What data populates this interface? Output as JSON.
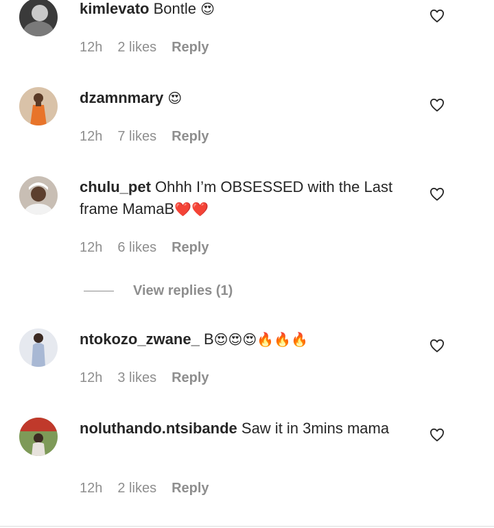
{
  "comments": [
    {
      "username": "kimlevato",
      "text": "Bontle",
      "emoji": "😍",
      "time": "12h",
      "likes": "2 likes",
      "reply": "Reply",
      "avatar_color": "#6b6b6b"
    },
    {
      "username": "dzamnmary",
      "text": "",
      "emoji": "😍",
      "time": "12h",
      "likes": "7 likes",
      "reply": "Reply",
      "avatar_color": "#e8742a"
    },
    {
      "username": "chulu_pet",
      "text": "Ohhh I’m OBSESSED with the Last frame MamaB",
      "emoji": "❤️❤️",
      "time": "12h",
      "likes": "6 likes",
      "reply": "Reply",
      "avatar_color": "#9a8f86"
    },
    {
      "username": "ntokozo_zwane_",
      "text": "B",
      "emoji": "😍😍😍🔥🔥🔥",
      "time": "12h",
      "likes": "3 likes",
      "reply": "Reply",
      "avatar_color": "#b9c4d6"
    },
    {
      "username": "noluthando.ntsibande",
      "text": "Saw it in 3mins mama",
      "emoji": "",
      "time": "12h",
      "likes": "2 likes",
      "reply": "Reply",
      "avatar_color": "#6d8a4a"
    }
  ],
  "view_replies": "View replies (1)",
  "icons": {
    "like": "heart-outline-icon"
  }
}
